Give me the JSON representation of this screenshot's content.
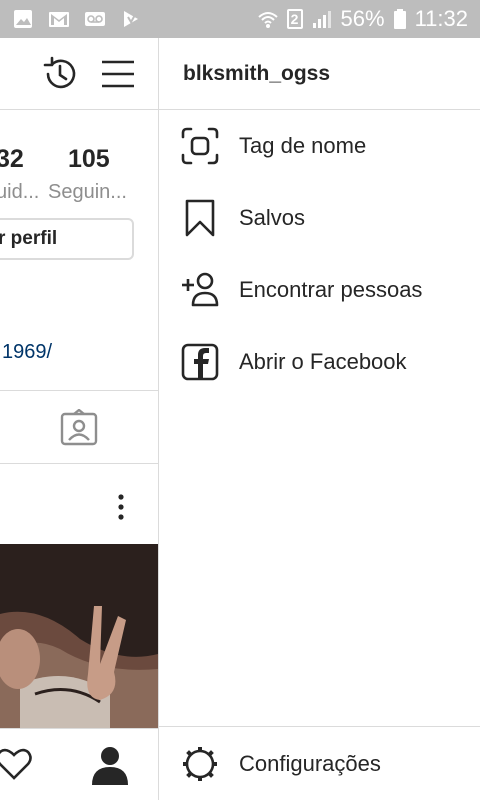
{
  "status_bar": {
    "battery": "56%",
    "time": "11:32",
    "sim_slot": "2",
    "left_icons": [
      "gallery-icon",
      "gmail-icon",
      "voicemail-icon",
      "play-store-icon"
    ],
    "right_icons": [
      "wifi-icon",
      "sim-icon",
      "signal-icon",
      "battery-icon"
    ]
  },
  "profile": {
    "stats": [
      {
        "number": "32",
        "label": "uid..."
      },
      {
        "number": "105",
        "label": "Seguin..."
      }
    ],
    "edit_profile_label": "r perfil",
    "bio_link": "1969/"
  },
  "drawer": {
    "username": "blksmith_ogss",
    "items": [
      {
        "label": "Tag de nome",
        "icon": "nametag-icon"
      },
      {
        "label": "Salvos",
        "icon": "bookmark-icon"
      },
      {
        "label": "Encontrar pessoas",
        "icon": "add-person-icon"
      },
      {
        "label": "Abrir o Facebook",
        "icon": "facebook-icon"
      }
    ],
    "footer_label": "Configurações",
    "footer_icon": "settings-icon"
  }
}
